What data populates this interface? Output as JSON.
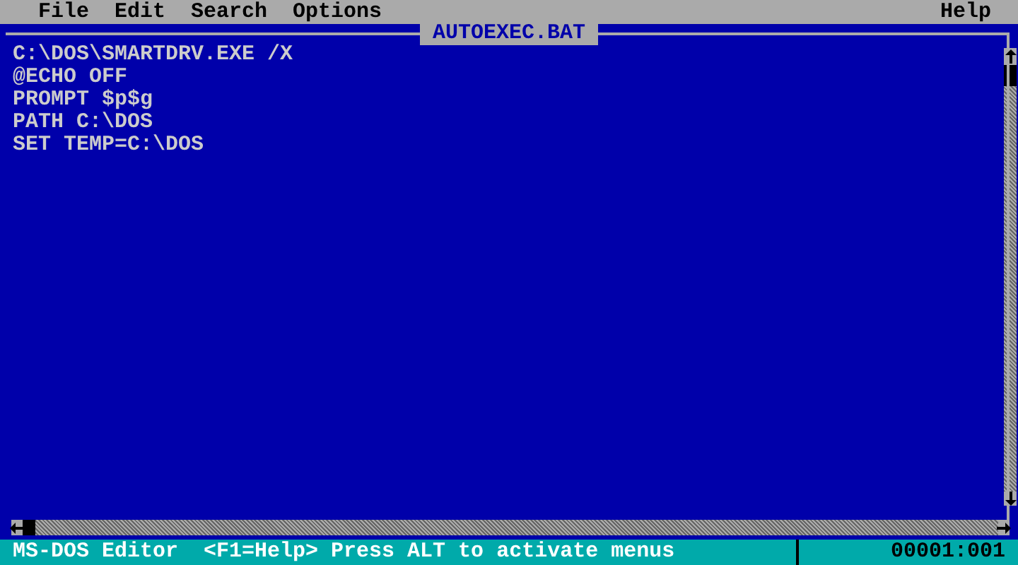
{
  "menu_bar": {
    "items": [
      {
        "label": "File"
      },
      {
        "label": "Edit"
      },
      {
        "label": "Search"
      },
      {
        "label": "Options"
      }
    ],
    "help": "Help"
  },
  "editor": {
    "title": "AUTOEXEC.BAT",
    "lines": [
      "C:\\DOS\\SMARTDRV.EXE /X",
      "@ECHO OFF",
      "PROMPT $p$g",
      "PATH C:\\DOS",
      "SET TEMP=C:\\DOS"
    ]
  },
  "status_bar": {
    "app": "MS-DOS Editor",
    "hint": "<F1=Help> Press ALT to activate menus",
    "position": "00001:001"
  }
}
